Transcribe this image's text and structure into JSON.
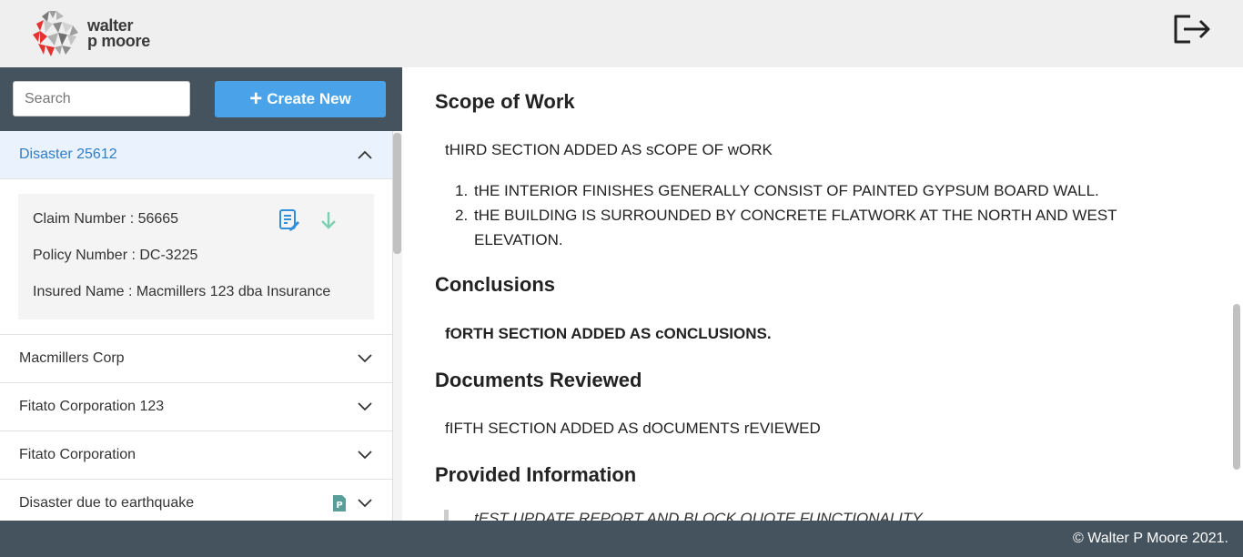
{
  "brand": {
    "line1": "walter",
    "line2": "p moore"
  },
  "header": {
    "logout_icon": "logout-icon"
  },
  "sidebar": {
    "search_placeholder": "Search",
    "create_label": "Create New",
    "items": [
      {
        "title": "Disaster 25612",
        "expanded": true,
        "claim": "Claim Number : 56665",
        "policy": "Policy Number : DC-3225",
        "insured": "Insured Name : Macmillers 123 dba Insurance"
      },
      {
        "title": "Macmillers Corp"
      },
      {
        "title": "Fitato Corporation 123"
      },
      {
        "title": "Fitato Corporation"
      },
      {
        "title": "Disaster due to earthquake",
        "icon": "p-document-icon"
      }
    ]
  },
  "report": {
    "scope_heading": "Scope of Work",
    "scope_text": "tHIRD SECTION ADDED AS sCOPE OF wORK",
    "scope_items": [
      {
        "num": "1.",
        "text": "tHE INTERIOR FINISHES GENERALLY CONSIST OF PAINTED GYPSUM BOARD WALL."
      },
      {
        "num": "2.",
        "text": "tHE BUILDING IS SURROUNDED BY CONCRETE FLATWORK AT THE NORTH AND WEST ELEVATION."
      }
    ],
    "conclusions_heading": "Conclusions",
    "conclusions_text": "fORTH SECTION ADDED AS cONCLUSIONS.",
    "documents_heading": "Documents Reviewed",
    "documents_text": "fIFTH SECTION ADDED AS dOCUMENTS rEVIEWED",
    "provided_heading": "Provided Information",
    "provided_quote": "tEST UPDATE REPORT AND BLOCK QUOTE FUNCTIONALITY"
  },
  "footer": {
    "copyright": "© Walter P Moore 2021."
  },
  "colors": {
    "accent": "#4aa3e8",
    "dark": "#45535f",
    "active_text": "#2f7ec8",
    "logo_red": "#e5312f"
  }
}
